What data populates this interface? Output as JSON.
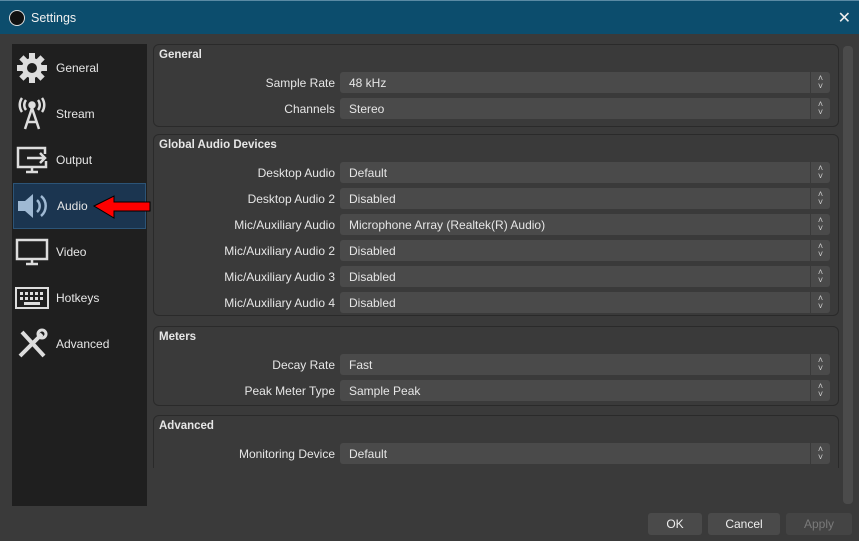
{
  "window": {
    "title": "Settings"
  },
  "sidebar": {
    "items": [
      {
        "label": "General",
        "icon": "gear-icon"
      },
      {
        "label": "Stream",
        "icon": "antenna-icon"
      },
      {
        "label": "Output",
        "icon": "output-monitor-icon"
      },
      {
        "label": "Audio",
        "icon": "speaker-icon",
        "active": true
      },
      {
        "label": "Video",
        "icon": "monitor-icon"
      },
      {
        "label": "Hotkeys",
        "icon": "keyboard-icon"
      },
      {
        "label": "Advanced",
        "icon": "tools-icon"
      }
    ]
  },
  "groups": [
    {
      "title": "General",
      "rows": [
        {
          "label": "Sample Rate",
          "value": "48 kHz"
        },
        {
          "label": "Channels",
          "value": "Stereo"
        }
      ]
    },
    {
      "title": "Global Audio Devices",
      "rows": [
        {
          "label": "Desktop Audio",
          "value": "Default"
        },
        {
          "label": "Desktop Audio 2",
          "value": "Disabled"
        },
        {
          "label": "Mic/Auxiliary Audio",
          "value": "Microphone Array (Realtek(R) Audio)"
        },
        {
          "label": "Mic/Auxiliary Audio 2",
          "value": "Disabled"
        },
        {
          "label": "Mic/Auxiliary Audio 3",
          "value": "Disabled"
        },
        {
          "label": "Mic/Auxiliary Audio 4",
          "value": "Disabled"
        }
      ]
    },
    {
      "title": "Meters",
      "rows": [
        {
          "label": "Decay Rate",
          "value": "Fast"
        },
        {
          "label": "Peak Meter Type",
          "value": "Sample Peak"
        }
      ]
    },
    {
      "title": "Advanced",
      "rows": [
        {
          "label": "Monitoring Device",
          "value": "Default"
        }
      ]
    }
  ],
  "buttons": {
    "ok": "OK",
    "cancel": "Cancel",
    "apply": "Apply"
  },
  "annotation": {
    "arrow_color": "#ff0000"
  }
}
